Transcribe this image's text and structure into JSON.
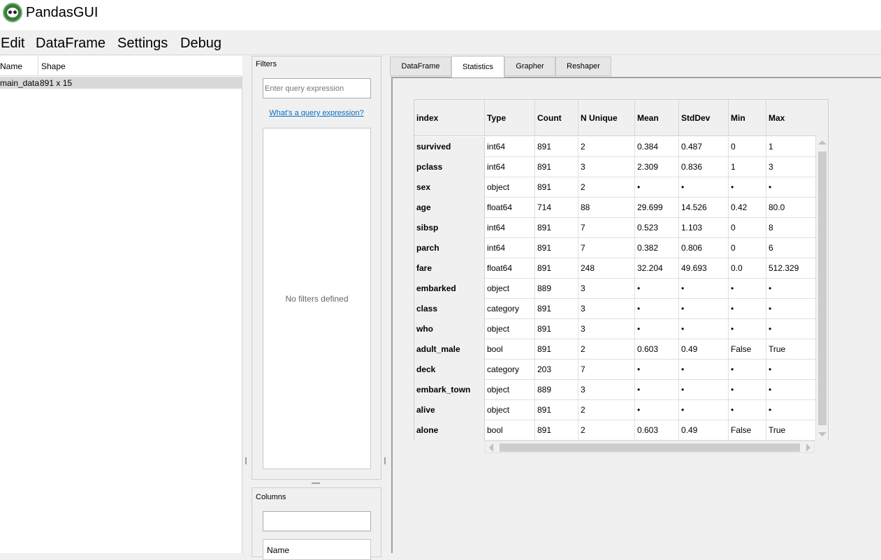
{
  "app": {
    "title": "PandasGUI",
    "icon": "panda-icon"
  },
  "menu": [
    "Edit",
    "DataFrame",
    "Settings",
    "Debug"
  ],
  "dataframes": {
    "headers": [
      "Name",
      "Shape"
    ],
    "rows": [
      {
        "name": "main_data",
        "shape": "891 x 15"
      }
    ]
  },
  "filters": {
    "title": "Filters",
    "placeholder": "Enter query expression",
    "help_link": "What's a query expression?",
    "empty_text": "No filters defined"
  },
  "columns_panel": {
    "title": "Columns",
    "header": "Name"
  },
  "tabs": [
    "DataFrame",
    "Statistics",
    "Grapher",
    "Reshaper"
  ],
  "active_tab": "Statistics",
  "stats": {
    "headers": [
      "index",
      "Type",
      "Count",
      "N Unique",
      "Mean",
      "StdDev",
      "Min",
      "Max"
    ],
    "rows": [
      [
        "survived",
        "int64",
        "891",
        "2",
        "0.384",
        "0.487",
        "0",
        "1"
      ],
      [
        "pclass",
        "int64",
        "891",
        "3",
        "2.309",
        "0.836",
        "1",
        "3"
      ],
      [
        "sex",
        "object",
        "891",
        "2",
        "•",
        "•",
        "•",
        "•"
      ],
      [
        "age",
        "float64",
        "714",
        "88",
        "29.699",
        "14.526",
        "0.42",
        "80.0"
      ],
      [
        "sibsp",
        "int64",
        "891",
        "7",
        "0.523",
        "1.103",
        "0",
        "8"
      ],
      [
        "parch",
        "int64",
        "891",
        "7",
        "0.382",
        "0.806",
        "0",
        "6"
      ],
      [
        "fare",
        "float64",
        "891",
        "248",
        "32.204",
        "49.693",
        "0.0",
        "512.329"
      ],
      [
        "embarked",
        "object",
        "889",
        "3",
        "•",
        "•",
        "•",
        "•"
      ],
      [
        "class",
        "category",
        "891",
        "3",
        "•",
        "•",
        "•",
        "•"
      ],
      [
        "who",
        "object",
        "891",
        "3",
        "•",
        "•",
        "•",
        "•"
      ],
      [
        "adult_male",
        "bool",
        "891",
        "2",
        "0.603",
        "0.49",
        "False",
        "True"
      ],
      [
        "deck",
        "category",
        "203",
        "7",
        "•",
        "•",
        "•",
        "•"
      ],
      [
        "embark_town",
        "object",
        "889",
        "3",
        "•",
        "•",
        "•",
        "•"
      ],
      [
        "alive",
        "object",
        "891",
        "2",
        "•",
        "•",
        "•",
        "•"
      ],
      [
        "alone",
        "bool",
        "891",
        "2",
        "0.603",
        "0.49",
        "False",
        "True"
      ]
    ]
  }
}
